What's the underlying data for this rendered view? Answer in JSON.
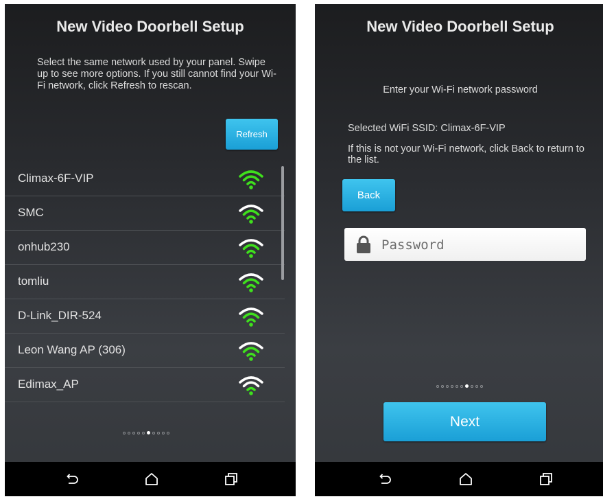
{
  "left_screen": {
    "title": "New Video Doorbell Setup",
    "instructions": "Select the same network used by your panel. Swipe up to see more options. If you still cannot find your Wi-Fi network, click Refresh to rescan.",
    "refresh_label": "Refresh",
    "networks": [
      {
        "name": "Climax-6F-VIP",
        "signal_icon": "wifi-icon"
      },
      {
        "name": "SMC",
        "signal_icon": "wifi-icon"
      },
      {
        "name": "onhub230",
        "signal_icon": "wifi-icon"
      },
      {
        "name": "tomliu",
        "signal_icon": "wifi-icon"
      },
      {
        "name": "D-Link_DIR-524",
        "signal_icon": "wifi-icon"
      },
      {
        "name": "Leon Wang AP (306)",
        "signal_icon": "wifi-icon"
      },
      {
        "name": "Edimax_AP",
        "signal_icon": "wifi-icon"
      }
    ],
    "page_indicator": {
      "total": 10,
      "current": 6
    }
  },
  "right_screen": {
    "title": "New Video Doorbell Setup",
    "prompt": "Enter your Wi-Fi network password",
    "selected_ssid": "Selected WiFi SSID:  Climax-6F-VIP",
    "hint": "If this is not your Wi-Fi network, click Back to return to the list.",
    "back_label": "Back",
    "password": {
      "value": "",
      "placeholder": "Password"
    },
    "page_indicator": {
      "total": 10,
      "current": 7
    },
    "next_label": "Next"
  },
  "nav_icons": [
    "back-icon",
    "home-icon",
    "recents-icon"
  ],
  "colors": {
    "accent": "#29b3e6",
    "wifi_green": "#3fe01d",
    "background": "#2a2c30"
  }
}
